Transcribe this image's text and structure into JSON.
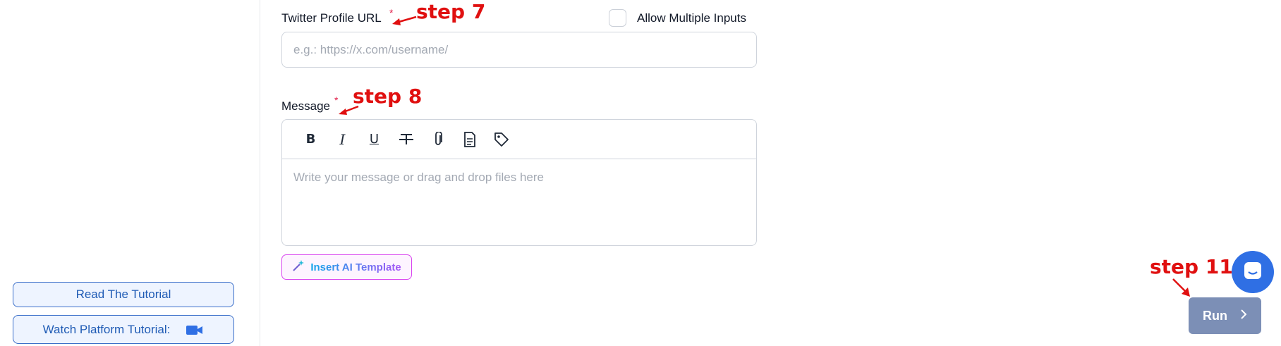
{
  "sidebar": {
    "read_tutorial": "Read The Tutorial",
    "watch_tutorial": "Watch Platform Tutorial:"
  },
  "form": {
    "twitter_label": "Twitter Profile URL",
    "twitter_placeholder": "e.g.: https://x.com/username/",
    "required_mark": "*",
    "allow_multiple_label": "Allow Multiple Inputs",
    "message_label": "Message",
    "message_placeholder": "Write your message or drag and drop files here",
    "toolbar": [
      "bold-icon",
      "italic-icon",
      "underline-icon",
      "strikethrough-icon",
      "attach-icon",
      "document-icon",
      "tag-icon"
    ],
    "bold_glyph": "B",
    "italic_glyph": "I",
    "underline_glyph": "U",
    "ai_template_label": "Insert AI Template"
  },
  "annotations": {
    "step7": "step 7",
    "step8": "step 8",
    "step11": "step 11"
  },
  "actions": {
    "run_label": "Run"
  },
  "colors": {
    "annotation": "#e01010",
    "run_button": "#7c8fb6",
    "chat_button": "#2f6fe4",
    "ai_border": "#d946ef"
  }
}
